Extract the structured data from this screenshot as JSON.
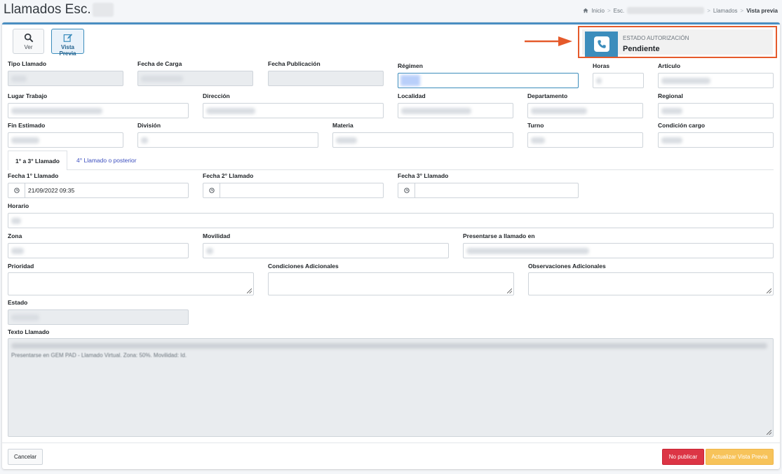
{
  "header": {
    "title": "Llamados Esc.",
    "breadcrumb": {
      "home": "Inicio",
      "item2": "Esc.",
      "item3": "Llamados",
      "active": "Vista previa",
      "sep": ">"
    }
  },
  "toolbar": {
    "ver_label": "Ver",
    "preview_label": "Vista Previa"
  },
  "status": {
    "label": "ESTADO AUTORIZACIÓN",
    "value": "Pendiente"
  },
  "fields": {
    "tipo_llamado": "Tipo Llamado",
    "fecha_carga": "Fecha de Carga",
    "fecha_publicacion": "Fecha Publicación",
    "regimen": "Régimen",
    "horas": "Horas",
    "articulo": "Artículo",
    "lugar_trabajo": "Lugar Trabajo",
    "direccion": "Dirección",
    "localidad": "Localidad",
    "departamento": "Departamento",
    "regional": "Regional",
    "fin_estimado": "Fin Estimado",
    "division": "División",
    "materia": "Materia",
    "turno": "Turno",
    "condicion_cargo": "Condición cargo",
    "fecha1": "Fecha 1° Llamado",
    "fecha2": "Fecha 2° Llamado",
    "fecha3": "Fecha 3° Llamado",
    "fecha1_value": "21/09/2022 09:35",
    "horario": "Horario",
    "zona": "Zona",
    "movilidad": "Movilidad",
    "presentarse": "Presentarse a llamado en",
    "prioridad": "Prioridad",
    "condiciones_adicionales": "Condiciones Adicionales",
    "observaciones_adicionales": "Observaciones Adicionales",
    "estado": "Estado",
    "texto_llamado": "Texto Llamado",
    "texto_line2": "Presentarse en GEM PAD - Llamado Virtual. Zona: 50%. Movilidad: Id."
  },
  "tabs": [
    {
      "label": "1° a 3° Llamado",
      "active": true
    },
    {
      "label": "4° Llamado o posterior",
      "active": false
    }
  ],
  "footer": {
    "cancel_label": "Cancelar",
    "no_publicar_label": "No publicar",
    "actualizar_label": "Actualizar Vista Previa"
  },
  "colors": {
    "accent": "#3c8dbc",
    "highlight_border": "#e55a2b",
    "danger": "#dc3545",
    "warning": "#f7c35a"
  },
  "icons": {
    "home": "home-icon",
    "search": "search-icon",
    "edit": "edit-icon",
    "phone": "phone-icon",
    "clock": "clock-icon",
    "arrow": "arrow-right-icon"
  }
}
